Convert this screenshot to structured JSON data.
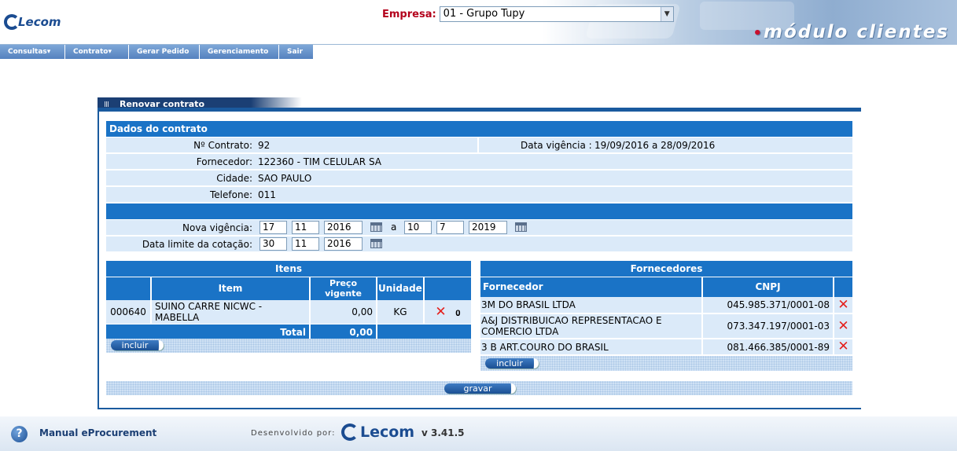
{
  "header": {
    "logo_text": "Lecom",
    "empresa_label": "Empresa:",
    "empresa_value": "01 - Grupo Tupy",
    "module_title": "módulo clientes"
  },
  "menu": {
    "items": [
      "Consultas▾",
      "Contrato▾",
      "Gerar Pedido",
      "Gerenciamento",
      "Sair"
    ]
  },
  "panel": {
    "title": "Renovar contrato",
    "section_title": "Dados do contrato",
    "contrato_label": "Nº Contrato:",
    "contrato_value": "92",
    "vigencia_label": "Data vigência :",
    "vigencia_value": "19/09/2016 a 28/09/2016",
    "fornecedor_label": "Fornecedor:",
    "fornecedor_value": "122360 - TIM CELULAR SA",
    "cidade_label": "Cidade:",
    "cidade_value": "SAO PAULO",
    "telefone_label": "Telefone:",
    "telefone_value": "011",
    "nova_vigencia_label": "Nova vigência:",
    "nova_inicio": {
      "dia": "17",
      "mes": "11",
      "ano": "2016"
    },
    "a_label": "a",
    "nova_fim": {
      "dia": "10",
      "mes": "7",
      "ano": "2019"
    },
    "limite_label": "Data limite da cotação:",
    "limite": {
      "dia": "30",
      "mes": "11",
      "ano": "2016"
    }
  },
  "itens": {
    "title": "Itens",
    "headers": {
      "item": "Item",
      "preco": "Preço vigente",
      "unidade": "Unidade"
    },
    "rows": [
      {
        "codigo": "000640",
        "item": "SUINO CARRE NICWC - MABELLA",
        "preco": "0,00",
        "unidade": "KG"
      }
    ],
    "total_label": "Total",
    "total_value": "0,00",
    "incluir_label": "incluir"
  },
  "fornecedores": {
    "title": "Fornecedores",
    "headers": {
      "fornecedor": "Fornecedor",
      "cnpj": "CNPJ"
    },
    "rows": [
      {
        "nome": "3M DO BRASIL LTDA",
        "cnpj": "045.985.371/0001-08"
      },
      {
        "nome": "A&J DISTRIBUICAO REPRESENTACAO E COMERCIO LTDA",
        "cnpj": "073.347.197/0001-03"
      },
      {
        "nome": "3 B ART.COURO DO BRASIL",
        "cnpj": "081.466.385/0001-89"
      }
    ],
    "incluir_label": "incluir"
  },
  "gravar_label": "gravar",
  "footer": {
    "manual_label": "Manual eProcurement",
    "dev_label": "Desenvolvido por:",
    "dev_logo": "Lecom",
    "version": "v 3.41.5"
  },
  "icons": {
    "remove": "close-icon",
    "attach": "paperclip-icon",
    "calendar": "calendar-icon",
    "help": "help-icon"
  }
}
